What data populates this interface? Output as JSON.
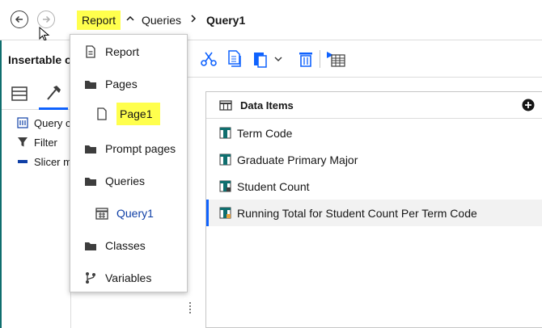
{
  "nav": {
    "back_icon": "arrow-left-circle-icon",
    "forward_icon": "arrow-right-circle-icon"
  },
  "breadcrumb": {
    "items": [
      "Report",
      "Queries",
      "Query1"
    ],
    "separators": [
      "chevron-up-icon",
      "chevron-right-icon"
    ]
  },
  "left_panel": {
    "title": "Insertable o",
    "tabs": [
      "data-items-tab-icon",
      "toolbox-hammer-icon"
    ],
    "tree": [
      {
        "label": "Query c",
        "icon": "query-calculation-icon"
      },
      {
        "label": "Filter",
        "icon": "filter-icon"
      },
      {
        "label": "Slicer m",
        "icon": "slicer-member-icon"
      }
    ]
  },
  "dropdown": {
    "items": [
      {
        "label": "Report",
        "icon": "document-icon"
      },
      {
        "label": "Pages",
        "icon": "folder-icon"
      },
      {
        "label": "Page1",
        "icon": "page-icon"
      },
      {
        "label": "Prompt pages",
        "icon": "folder-icon"
      },
      {
        "label": "Queries",
        "icon": "folder-icon"
      },
      {
        "label": "Query1",
        "icon": "query-table-icon"
      },
      {
        "label": "Classes",
        "icon": "folder-icon"
      },
      {
        "label": "Variables",
        "icon": "variables-branch-icon"
      }
    ]
  },
  "toolbar": {
    "buttons": [
      "cut-icon",
      "copy-icon",
      "paste-icon",
      "delete-icon",
      "table-add-icon"
    ]
  },
  "data_items": {
    "title": "Data Items",
    "add_icon": "add-circle-icon",
    "rows": [
      "Term Code",
      "Graduate Primary Major",
      "Student Count",
      "Running Total for Student Count Per Term Code"
    ]
  },
  "colors": {
    "highlight": "#ffff4d",
    "accent": "#0f62fe",
    "link": "#0f3fa6",
    "teal": "#0f6e6e"
  }
}
